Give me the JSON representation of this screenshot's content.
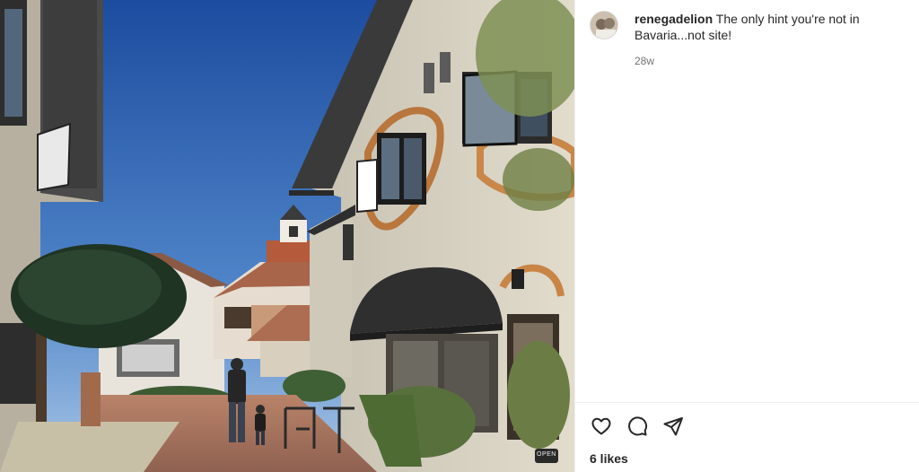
{
  "post": {
    "username": "renegadelion",
    "caption": "The only hint you're not in Bavaria...not site!",
    "timestamp": "28w",
    "likes": "6 likes",
    "photo_sign_text": "OPEN"
  },
  "actions": {
    "like_icon": "heart-icon",
    "comment_icon": "comment-icon",
    "share_icon": "share-icon"
  },
  "colors": {
    "sky_top": "#1f4fa3",
    "sky_bottom": "#9cc0e8",
    "stucco": "#d9d3c4",
    "awning": "#2f2f2f",
    "text_primary": "#262626",
    "text_secondary": "#737373"
  }
}
